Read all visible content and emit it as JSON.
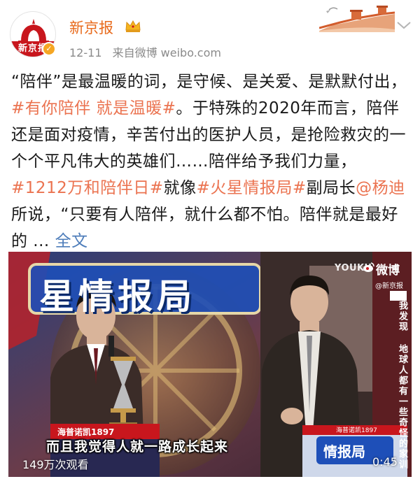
{
  "account": {
    "name": "新京报",
    "avatar_plate": "新京报",
    "verified_icon": "check-icon",
    "crown_icon": "crown-icon"
  },
  "meta": {
    "date": "12-11",
    "source": "来自微博 weibo.com"
  },
  "post": {
    "p1": "“陪伴”是最温暖的词，是守候、是关爱、是默默付出，",
    "tag1": "#有你陪伴 就是温暖#",
    "p2": "。于特殊的2020年而言，陪伴还是面对疫情，辛苦付出的医护人员，是抢险救灾的一个个平凡伟大的英雄们……陪伴给予我们力量，",
    "tag2": "#1212万和陪伴日#",
    "p3": "就像",
    "tag3": "#火星情报局#",
    "p4": "副局长",
    "mention": "@杨迪",
    "p5": " 所说，“只要有人陪伴，就什么都不怕。陪伴就是最好的 ... ",
    "more": "全文"
  },
  "video": {
    "watermark_platform": "YOUKU",
    "watermark_weibo": "微博",
    "watermark_source": "@新京报",
    "side_caption": "我发现 地球人都有一些奇怪的家训",
    "subtitle": "而且我觉得人就一路成长起来",
    "views": "149万次观看",
    "duration": "0:45",
    "stage_sign": "星情报局",
    "sponsor_left": "海普诺凯1897",
    "sponsor_right": "海普诺凯1897",
    "podium_right": "情报局"
  },
  "colors": {
    "accent_orange": "#e86b1d",
    "tag_color": "#eb7350",
    "link_blue": "#4e7dba",
    "meta_gray": "#8a8a8a"
  }
}
